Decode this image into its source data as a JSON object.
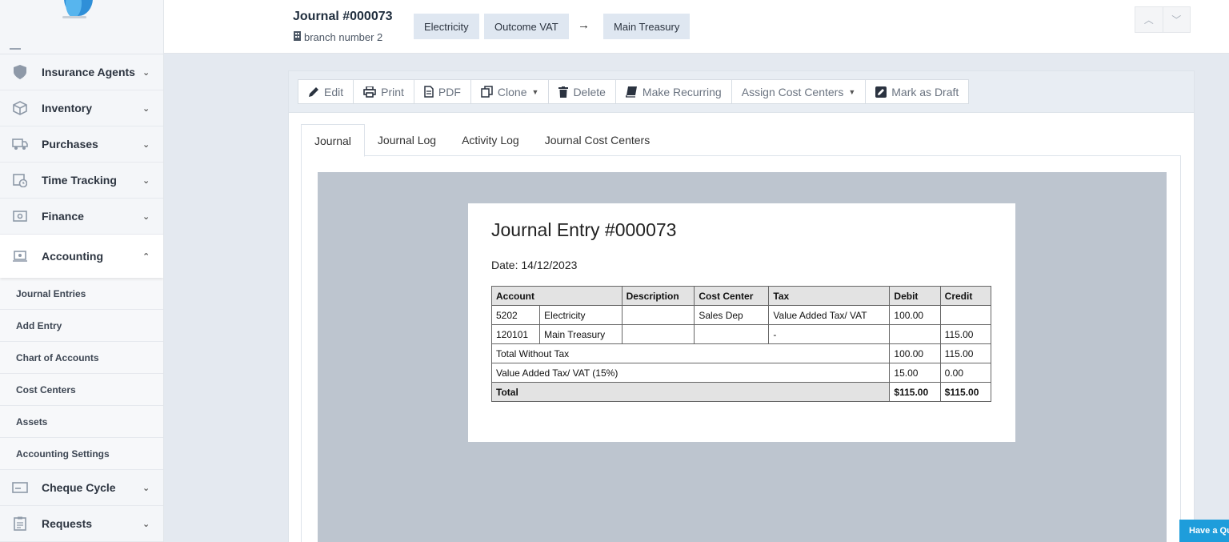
{
  "sidebar": {
    "items_top": [
      {
        "label": "Insurance Agents",
        "icon": "shield-icon"
      },
      {
        "label": "Inventory",
        "icon": "box-icon"
      },
      {
        "label": "Purchases",
        "icon": "truck-icon"
      },
      {
        "label": "Time Tracking",
        "icon": "calendar-clock-icon"
      },
      {
        "label": "Finance",
        "icon": "money-icon"
      }
    ],
    "active": {
      "label": "Accounting",
      "icon": "accounting-icon"
    },
    "sub_items": [
      "Journal Entries",
      "Add Entry",
      "Chart of Accounts",
      "Cost Centers",
      "Assets",
      "Accounting Settings"
    ],
    "items_bottom": [
      {
        "label": "Cheque Cycle",
        "icon": "cheque-icon"
      },
      {
        "label": "Requests",
        "icon": "clipboard-icon"
      }
    ]
  },
  "header": {
    "title": "Journal #000073",
    "branch": "branch number 2",
    "chips": [
      "Electricity",
      "Outcome VAT",
      "Main Treasury"
    ],
    "arrow": "→"
  },
  "toolbar": {
    "edit": "Edit",
    "print": "Print",
    "pdf": "PDF",
    "clone": "Clone",
    "delete": "Delete",
    "recurring": "Make Recurring",
    "cost_centers": "Assign Cost Centers",
    "draft": "Mark as Draft"
  },
  "tabs": [
    "Journal",
    "Journal Log",
    "Activity Log",
    "Journal Cost Centers"
  ],
  "document": {
    "title": "Journal Entry #000073",
    "date": "Date: 14/12/2023",
    "headers": [
      "Account",
      "Description",
      "Cost Center",
      "Tax",
      "Debit",
      "Credit"
    ],
    "rows": [
      [
        "5202",
        "Electricity",
        "",
        "Sales Dep",
        "Value Added Tax/ VAT",
        "100.00",
        ""
      ],
      [
        "120101",
        "Main Treasury",
        "",
        "",
        "-",
        "",
        "115.00"
      ]
    ],
    "total_without_tax": {
      "label": "Total Without Tax",
      "debit": "100.00",
      "credit": "115.00"
    },
    "vat": {
      "label": "Value Added Tax/ VAT (15%)",
      "debit": "15.00",
      "credit": "0.00"
    },
    "total": {
      "label": "Total",
      "debit": "$115.00",
      "credit": "$115.00"
    }
  },
  "cta": "Have a Qu"
}
